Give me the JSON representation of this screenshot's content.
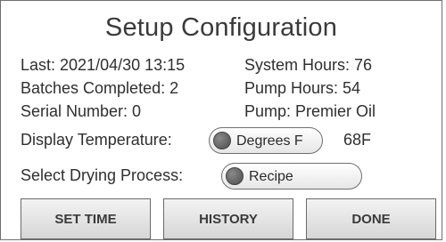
{
  "title": "Setup Configuration",
  "info": {
    "last": "Last: 2021/04/30 13:15",
    "batches": "Batches Completed: 2",
    "serial": "Serial Number: 0",
    "system_hours": "System Hours: 76",
    "pump_hours": "Pump Hours: 54",
    "pump": "Pump: Premier Oil"
  },
  "display_temperature": {
    "label": "Display Temperature:",
    "toggle_label": "Degrees F",
    "value": "68F"
  },
  "drying_process": {
    "label": "Select Drying Process:",
    "toggle_label": "Recipe"
  },
  "buttons": {
    "set_time": "SET TIME",
    "history": "HISTORY",
    "done": "DONE"
  }
}
